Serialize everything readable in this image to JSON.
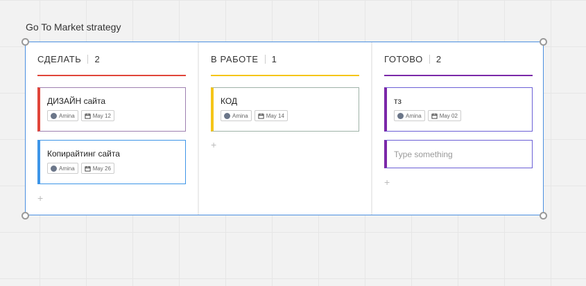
{
  "frame": {
    "title": "Go To Market strategy"
  },
  "columns": [
    {
      "title": "СДЕЛАТЬ",
      "count": "2",
      "color": "#e0453a",
      "cards": [
        {
          "title": "ДИЗАЙН сайта",
          "assignee": "Amina",
          "date": "May 12",
          "color": "#e0453a",
          "border": "#9e7fb0"
        },
        {
          "title": "Копирайтинг сайта",
          "assignee": "Amina",
          "date": "May 26",
          "color": "#3d95e8",
          "border": "#3d95e8"
        }
      ],
      "add_label": "+"
    },
    {
      "title": "В РАБОТЕ",
      "count": "1",
      "color": "#f5c518",
      "cards": [
        {
          "title": "КОД",
          "assignee": "Amina",
          "date": "May 14",
          "color": "#f5c518",
          "border": "#9fb2a8"
        }
      ],
      "add_label": "+"
    },
    {
      "title": "ГОТОВО",
      "count": "2",
      "color": "#7b28a8",
      "cards": [
        {
          "title": "тз",
          "assignee": "Amina",
          "date": "May 02",
          "color": "#7b28a8",
          "border": "#6b5fd6"
        }
      ],
      "placeholder": "Type something",
      "add_label": "+"
    }
  ]
}
